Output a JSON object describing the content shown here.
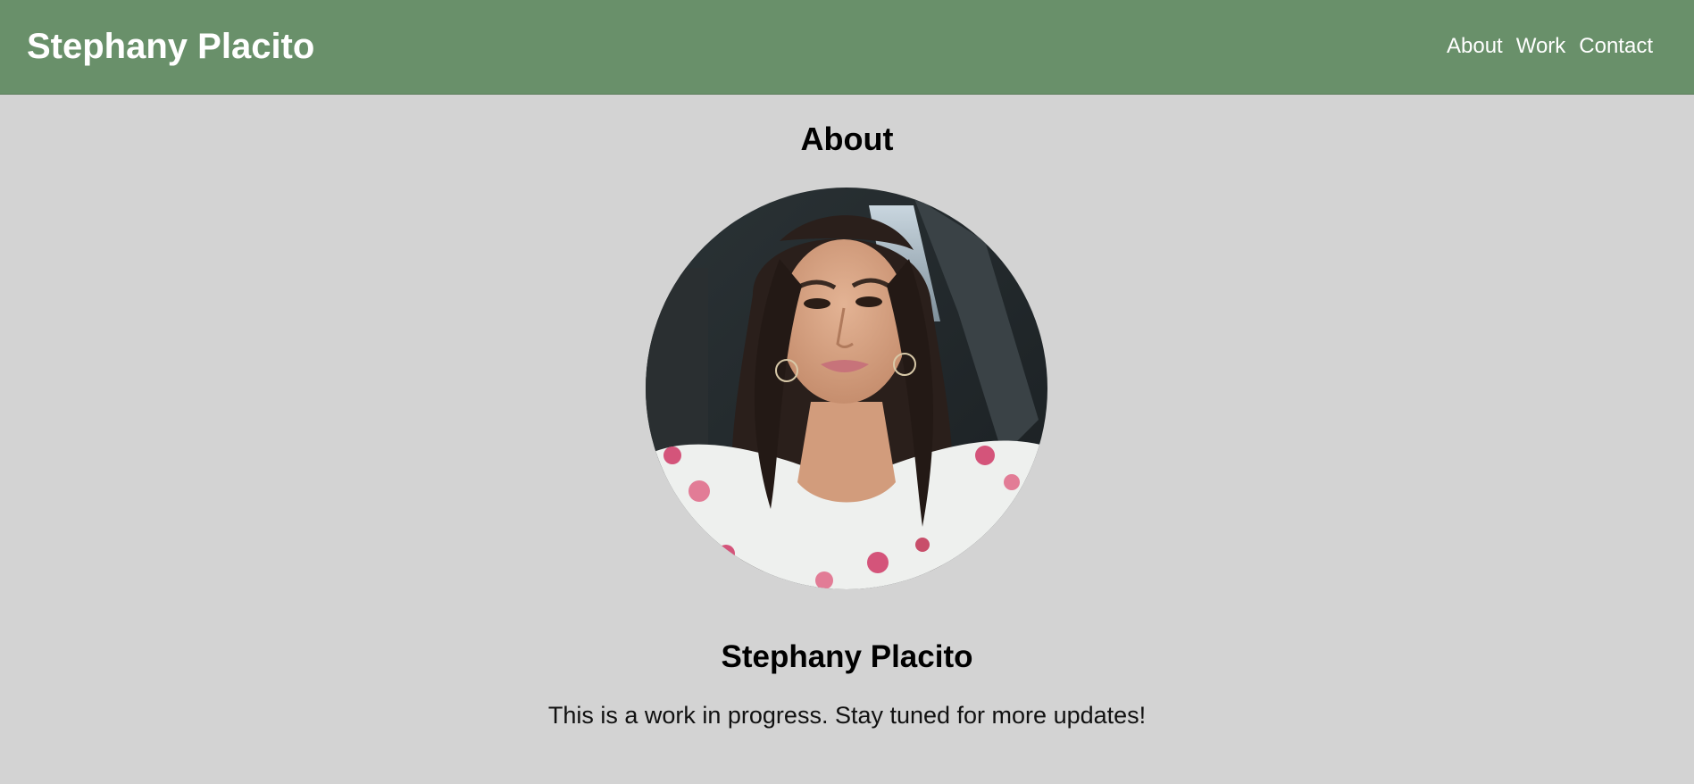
{
  "header": {
    "site_title": "Stephany Placito",
    "nav": [
      "About",
      "Work",
      "Contact"
    ]
  },
  "main": {
    "section_heading": "About",
    "profile_photo": "portrait photo",
    "name": "Stephany Placito",
    "bio": "This is a work in progress. Stay tuned for more updates!"
  },
  "colors": {
    "header_bg": "#69906a",
    "page_bg": "#d3d3d3",
    "header_text": "#ffffff",
    "body_text": "#000000"
  }
}
